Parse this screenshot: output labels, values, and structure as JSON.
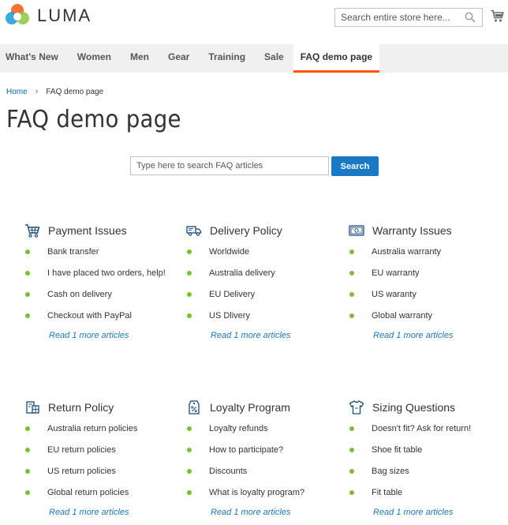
{
  "header": {
    "logo_text": "LUMA",
    "search_placeholder": "Search entire store here..."
  },
  "nav": {
    "items": [
      "What's New",
      "Women",
      "Men",
      "Gear",
      "Training",
      "Sale",
      "FAQ demo page"
    ]
  },
  "breadcrumbs": {
    "home": "Home",
    "separator": "›",
    "current": "FAQ demo page"
  },
  "page": {
    "title": "FAQ demo page"
  },
  "faq_search": {
    "placeholder": "Type here to search FAQ articles",
    "button_label": "Search"
  },
  "colors": {
    "accent": "#ff5501",
    "link": "#1979c3",
    "bullet": "#7bbf2f",
    "button": "#1979c3"
  },
  "categories": [
    {
      "icon": "cart-icon",
      "title": "Payment Issues",
      "items": [
        "Bank transfer",
        "I have placed two orders, help!",
        "Cash on delivery",
        "Checkout with PayPal"
      ],
      "more": "Read 1 more articles"
    },
    {
      "icon": "truck-icon",
      "title": "Delivery Policy",
      "items": [
        "Worldwide",
        "Australia delivery",
        "EU Delivery",
        "US Dlivery"
      ],
      "more": "Read 1 more articles"
    },
    {
      "icon": "credit-card-icon",
      "title": "Warranty Issues",
      "items": [
        "Australia warranty",
        "EU warranty",
        "US waranty",
        "Global warranty"
      ],
      "more": "Read 1 more articles"
    },
    {
      "icon": "return-box-icon",
      "title": "Return Policy",
      "items": [
        "Australia return policies",
        "EU return policies",
        "US return policies",
        "Global return policies"
      ],
      "more": "Read 1 more articles"
    },
    {
      "icon": "discount-tag-icon",
      "title": "Loyalty Program",
      "items": [
        "Loyalty refunds",
        "How to participate?",
        "Discounts",
        "What is loyalty program?"
      ],
      "more": "Read 1 more articles"
    },
    {
      "icon": "shirt-icon",
      "title": "Sizing Questions",
      "items": [
        "Doesn't fit? Ask for return!",
        "Shoe fit table",
        "Bag sizes",
        "Fit table"
      ],
      "more": "Read 1 more articles"
    }
  ]
}
